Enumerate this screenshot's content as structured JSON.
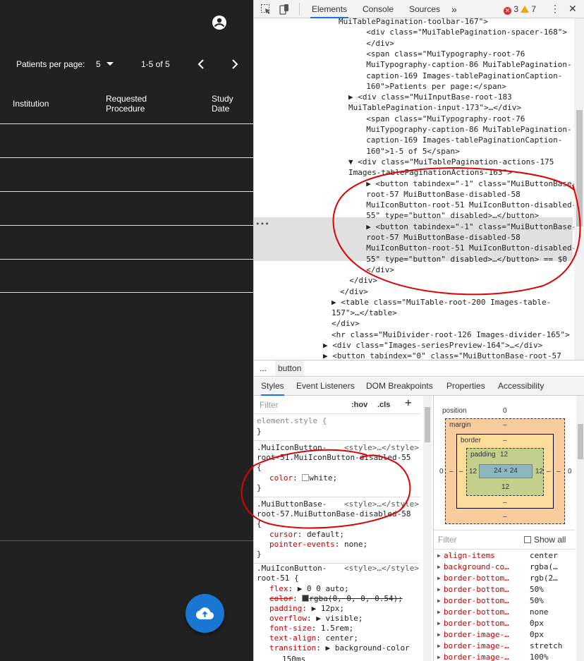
{
  "app": {
    "pagination": {
      "label": "Patients per page:",
      "rows_per_page": "5",
      "range": "1-5 of 5"
    },
    "table": {
      "headers": [
        "Institution",
        "Requested Procedure",
        "Study Date"
      ],
      "rows": 5
    }
  },
  "devtools": {
    "tabs": [
      "Elements",
      "Console",
      "Sources",
      "»"
    ],
    "errors": "3",
    "warnings": "7",
    "dom_lines": [
      "MuiTablePagination-toolbar-167\">",
      "  <div class=\"MuiTablePagination-spacer-168\">",
      "  </div>",
      "  <span class=\"MuiTypography-root-76",
      "  MuiTypography-caption-86 MuiTablePagination-",
      "  caption-169 Images-tablePaginationCaption-",
      "  160\">Patients per page:</span>",
      "▶ <div class=\"MuiInputBase-root-183",
      "MuiTablePagination-input-173\">…</div>",
      "  <span class=\"MuiTypography-root-76",
      "  MuiTypography-caption-86 MuiTablePagination-",
      "  caption-169 Images-tablePaginationCaption-",
      "  160\">1-5 of 5</span>",
      "▼ <div class=\"MuiTablePagination-actions-175",
      "Images-tablePaginationActions-163\">",
      "  ▶ <button tabindex=\"-1\" class=\"MuiButtonBase-",
      "  root-57 MuiButtonBase-disabled-58",
      "  MuiIconButton-root-51 MuiIconButton-disabled-",
      "  55\" type=\"button\" disabled>…</button>",
      "  ▶ <button tabindex=\"-1\" class=\"MuiButtonBase-",
      "  root-57 MuiButtonBase-disabled-58",
      "  MuiIconButton-root-51 MuiIconButton-disabled-",
      "  55\" type=\"button\" disabled>…</button> == $0",
      "  </div>",
      "  </div>",
      "</div>",
      "▶ <table class=\"MuiTable-root-200 Images-table-",
      "157\">…</table>",
      "</div>",
      "<hr class=\"MuiDivider-root-126 Images-divider-165\">",
      "▶ <div class=\"Images-seriesPreview-164\">…</div>",
      "▶ <button tabindex=\"0\" class=\"MuiButtonBase-root-57"
    ],
    "breadcrumb": {
      "ellipsis": "...",
      "current": "button"
    },
    "subtabs": [
      "Styles",
      "Event Listeners",
      "DOM Breakpoints",
      "Properties",
      "Accessibility"
    ],
    "styles": {
      "filter_placeholder": "Filter",
      "hov": ":hov",
      "cls": ".cls",
      "plus": "+",
      "element_style": "element.style {",
      "close": "}",
      "rule1_sel1": ".MuiIconButton-",
      "rule1_sel2": "root-51.MuiIconButton-disabled-55",
      "rule1_open": "{",
      "rule1_prop": "color",
      "rule1_val": "white;",
      "rule2_sel1": ".MuiButtonBase-",
      "rule2_sel2": "root-57.MuiButtonBase-disabled-58",
      "rule2_open": "{",
      "rule2_prop1": "cursor",
      "rule2_val1": "default;",
      "rule2_prop2": "pointer-events",
      "rule2_val2": "none;",
      "rule3_sel1": ".MuiIconButton-",
      "rule3_sel2": "root-51 {",
      "source": "<style>…</style>",
      "rule3_props": [
        {
          "p": "flex",
          "v": "▶ 0 0 auto;"
        },
        {
          "p": "color",
          "v": "rgba(0, 0, 0, 0.54);"
        },
        {
          "p": "padding",
          "v": "▶ 12px;"
        },
        {
          "p": "overflow",
          "v": "▶ visible;"
        },
        {
          "p": "font-size",
          "v": "1.5rem;"
        },
        {
          "p": "text-align",
          "v": "center;"
        },
        {
          "p": "transition",
          "v": "▶ background-color"
        }
      ],
      "rule3_cont": "150ms"
    },
    "boxmodel": {
      "position": "position",
      "position_val": "0",
      "margin": "margin",
      "margin_val": "–",
      "border": "border",
      "border_val": "–",
      "padding": "padding",
      "padding_val": "12",
      "content": "24 × 24",
      "left_outer": "0",
      "right_outer": "0",
      "left_dash": "–",
      "right_dash": "–",
      "left_pad": "12",
      "right_pad": "12",
      "bottom_pad": "12",
      "bottom_border": "–",
      "bottom_margin": "–",
      "bottom_pos": "0"
    },
    "computed": {
      "filter_placeholder": "Filter",
      "show_all": "Show all",
      "props": [
        {
          "n": "align-items",
          "v": "center"
        },
        {
          "n": "background-co…",
          "v": "rgba(…"
        },
        {
          "n": "border-bottom…",
          "v": "rgb(2…"
        },
        {
          "n": "border-bottom…",
          "v": "50%"
        },
        {
          "n": "border-bottom…",
          "v": "50%"
        },
        {
          "n": "border-bottom…",
          "v": "none"
        },
        {
          "n": "border-bottom…",
          "v": "0px"
        },
        {
          "n": "border-image-…",
          "v": "0px"
        },
        {
          "n": "border-image-…",
          "v": "stretch"
        },
        {
          "n": "border-image-…",
          "v": "100%"
        }
      ]
    }
  }
}
